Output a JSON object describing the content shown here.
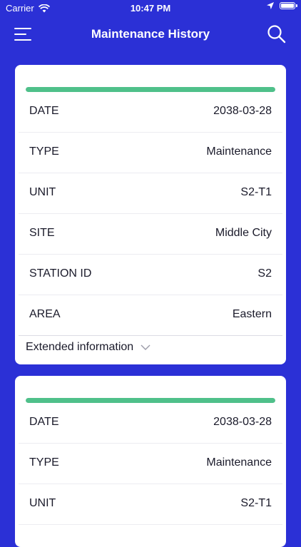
{
  "status_bar": {
    "carrier": "Carrier",
    "time": "10:47 PM"
  },
  "header": {
    "title": "Maintenance History",
    "menu_icon": "hamburger-menu-icon",
    "search_icon": "search-icon"
  },
  "colors": {
    "background": "#2b30d6",
    "progress": "#4fc08a",
    "card": "#ffffff"
  },
  "records": [
    {
      "progress_fraction": 1.0,
      "fields": [
        {
          "label": "DATE",
          "value": "2038-03-28"
        },
        {
          "label": "TYPE",
          "value": "Maintenance"
        },
        {
          "label": "UNIT",
          "value": "S2-T1"
        },
        {
          "label": "SITE",
          "value": "Middle City"
        },
        {
          "label": "STATION ID",
          "value": "S2"
        },
        {
          "label": "AREA",
          "value": "Eastern"
        }
      ],
      "extended_label": "Extended information"
    },
    {
      "progress_fraction": 1.0,
      "fields": [
        {
          "label": "DATE",
          "value": "2038-03-28"
        },
        {
          "label": "TYPE",
          "value": "Maintenance"
        },
        {
          "label": "UNIT",
          "value": "S2-T1"
        }
      ]
    }
  ]
}
